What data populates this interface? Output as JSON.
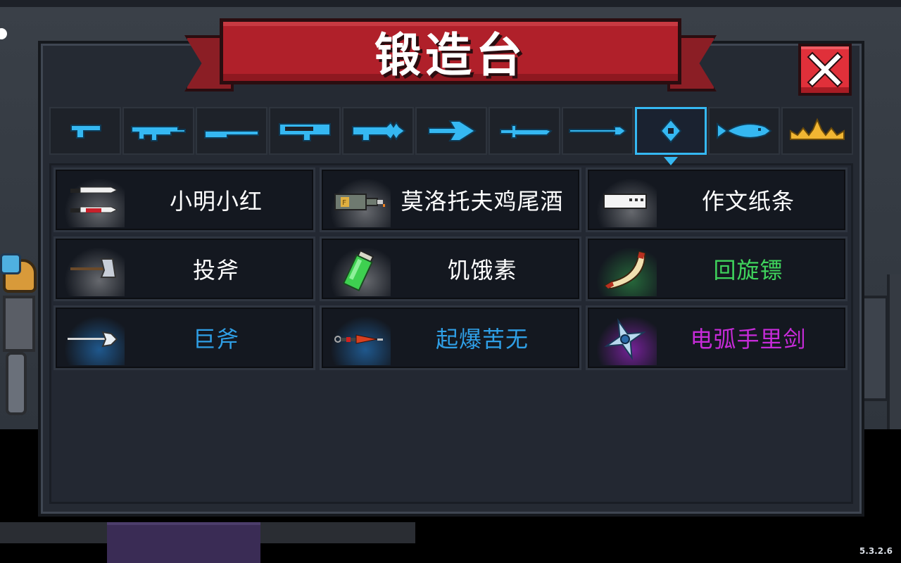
{
  "title": "锻造台",
  "version": "5.3.2.6",
  "close_button": {
    "icon": "close-icon"
  },
  "category_tabs": [
    {
      "icon": "pistol-icon",
      "selected": false
    },
    {
      "icon": "assault-rifle-icon",
      "selected": false
    },
    {
      "icon": "shotgun-icon",
      "selected": false
    },
    {
      "icon": "rocket-launcher-icon",
      "selected": false
    },
    {
      "icon": "laser-gun-icon",
      "selected": false
    },
    {
      "icon": "bow-icon",
      "selected": false
    },
    {
      "icon": "sword-icon",
      "selected": false
    },
    {
      "icon": "spear-icon",
      "selected": false
    },
    {
      "icon": "throwing-weapon-icon",
      "selected": true
    },
    {
      "icon": "fish-icon",
      "selected": false
    },
    {
      "icon": "crown-icon",
      "selected": false
    }
  ],
  "colors": {
    "tab_icon": "#35b8f2",
    "crown_icon": "#f2b632",
    "rarity_white": "#ffffff",
    "rarity_green": "#3fd35c",
    "rarity_blue": "#2f9fe6",
    "rarity_purple": "#c62bd8",
    "banner": "#b0202a",
    "close": "#e0303a"
  },
  "items": [
    {
      "name": "小明小红",
      "icon": "twin-knives-icon",
      "rarity": "white"
    },
    {
      "name": "莫洛托夫鸡尾酒",
      "icon": "molotov-bottle-icon",
      "rarity": "white"
    },
    {
      "name": "作文纸条",
      "icon": "paper-strip-icon",
      "rarity": "white"
    },
    {
      "name": "投斧",
      "icon": "throwing-axe-icon",
      "rarity": "white"
    },
    {
      "name": "饥饿素",
      "icon": "green-vial-icon",
      "rarity": "white"
    },
    {
      "name": "回旋镖",
      "icon": "boomerang-icon",
      "rarity": "green"
    },
    {
      "name": "巨斧",
      "icon": "great-axe-icon",
      "rarity": "blue"
    },
    {
      "name": "起爆苦无",
      "icon": "explosive-kunai-icon",
      "rarity": "blue"
    },
    {
      "name": "电弧手里剑",
      "icon": "arc-shuriken-icon",
      "rarity": "purple"
    }
  ]
}
